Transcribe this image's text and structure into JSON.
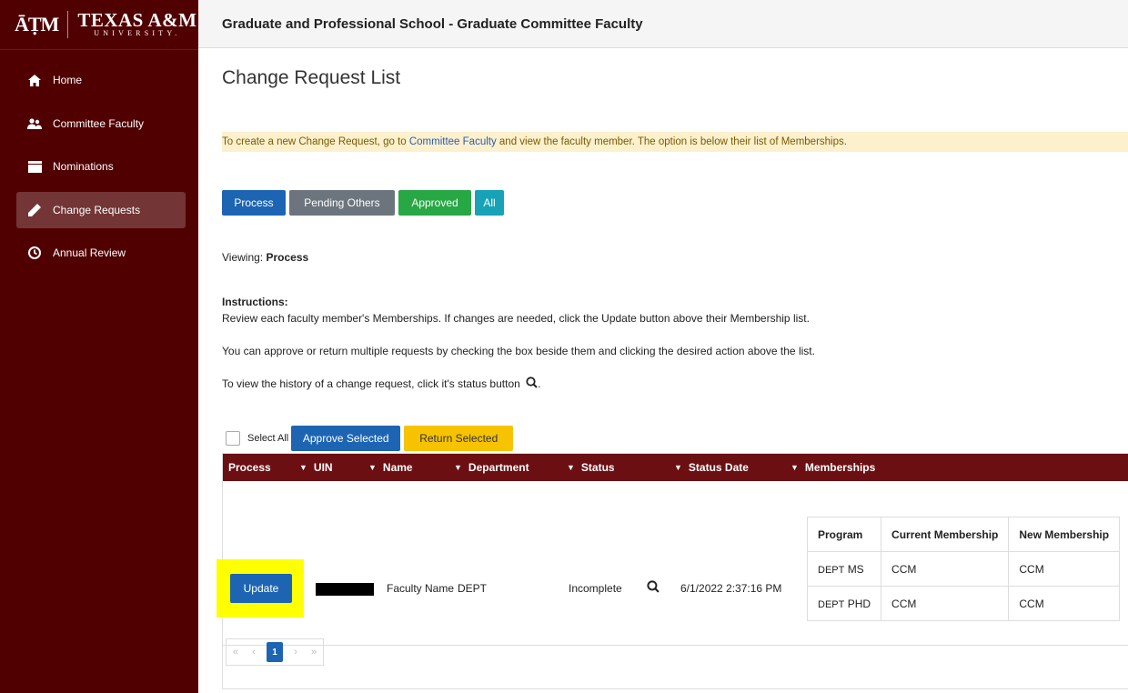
{
  "brand": {
    "logo_mark": "ĀṬM",
    "name_line1": "TEXAS A&M",
    "name_line2": "UNIVERSITY."
  },
  "sidebar": {
    "items": [
      {
        "label": "Home",
        "icon": "home-icon",
        "active": false
      },
      {
        "label": "Committee Faculty",
        "icon": "users-icon",
        "active": false
      },
      {
        "label": "Nominations",
        "icon": "folder-icon",
        "active": false
      },
      {
        "label": "Change Requests",
        "icon": "pencil-icon",
        "active": true
      },
      {
        "label": "Annual Review",
        "icon": "clock-icon",
        "active": false
      }
    ]
  },
  "header": {
    "title": "Graduate and Professional School - Graduate Committee Faculty"
  },
  "main": {
    "title": "Change Request List",
    "notice": {
      "before": "To create a new Change Request, go to ",
      "link": "Committee Faculty",
      "after": " and view the faculty member. The option is below their list of Memberships."
    },
    "filters": [
      "Process",
      "Pending Others",
      "Approved",
      "All"
    ],
    "viewing_label": "Viewing: ",
    "viewing_value": "Process",
    "instructions": {
      "heading": "Instructions:",
      "line1": "Review each faculty member's Memberships. If changes are needed, click the Update button above their Membership list.",
      "line2": "You can approve or return multiple requests by checking the box beside them and clicking the desired action above the list.",
      "line3": "To view the history of a change request, click it's status button"
    },
    "select_all": "Select All",
    "approve_selected": "Approve Selected",
    "return_selected": "Return Selected"
  },
  "grid": {
    "columns": [
      "Process",
      "UIN",
      "Name",
      "Department",
      "Status",
      "Status Date",
      "Memberships"
    ],
    "rows": [
      {
        "action": "Update",
        "name": "Faculty Name",
        "department": "DEPT",
        "status": "Incomplete",
        "status_date": "6/1/2022 2:37:16 PM",
        "memberships": {
          "headers": [
            "Program",
            "Current Membership",
            "New Membership"
          ],
          "rows": [
            {
              "dept": "DEPT",
              "program": "MS",
              "current": "CCM",
              "new": "CCM"
            },
            {
              "dept": "DEPT",
              "program": "PHD",
              "current": "CCM",
              "new": "CCM"
            }
          ]
        }
      }
    ],
    "pager": {
      "first": "«",
      "prev": "‹",
      "current": "1",
      "next": "›",
      "last": "»"
    }
  },
  "colors": {
    "maroon": "#500000",
    "primary": "#1d65b3",
    "highlight": "#ffff00"
  }
}
